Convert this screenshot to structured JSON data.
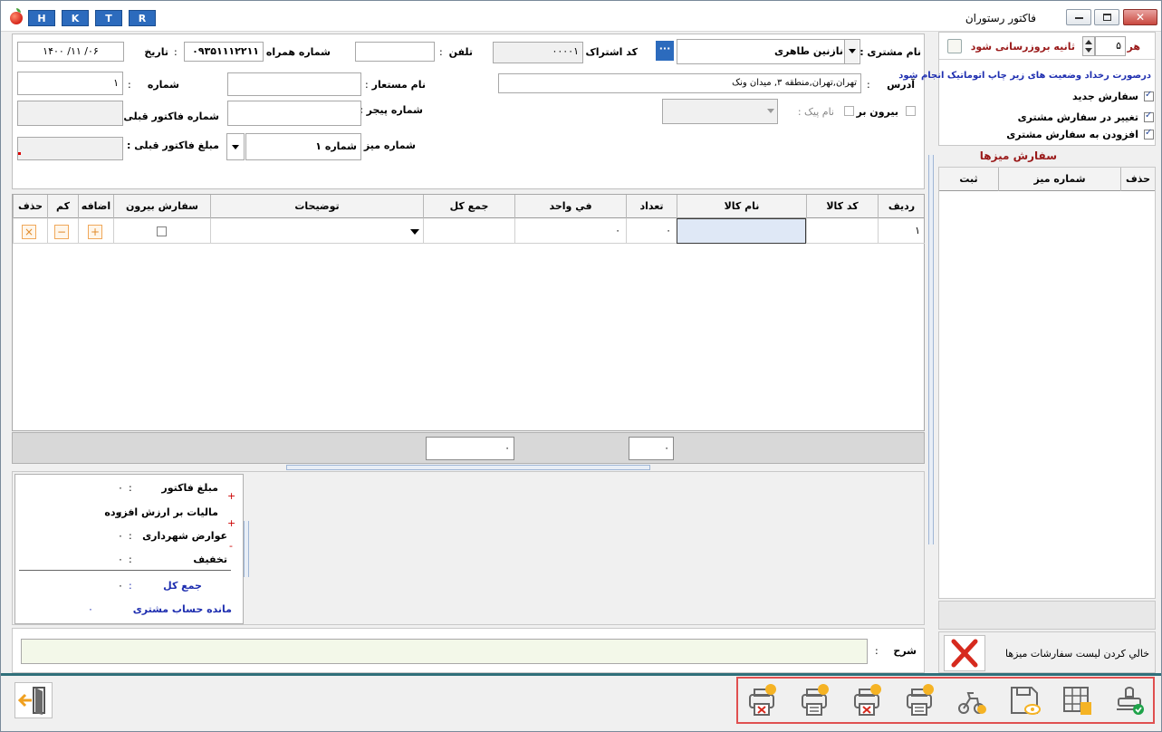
{
  "window": {
    "title": "فاكتور رستوران",
    "quick_buttons": [
      "H",
      "K",
      "T",
      "R"
    ]
  },
  "header": {
    "customer_name_label": "نام مشتری :",
    "customer_name_value": "نازنین طاهری",
    "subscription_code_label": "کد اشتراک :",
    "subscription_code_value": "۰۰۰۰۱",
    "phone_label": "تلفن",
    "phone_value": "",
    "mobile_label": "شماره همراه :",
    "mobile_value": "۰۹۳۵۱۱۱۲۲۱۱",
    "date_label": "تاریخ",
    "date_value": "۱۴۰۰  /۱۱  /۰۶",
    "address_label": "آدرس",
    "address_value": "تهران,تهران,منطقه ۳, میدان ونک",
    "alias_label": "نام مستعار",
    "alias_value": "",
    "number_label": "شماره",
    "number_value": "۱",
    "pager_label": "شماره پیجر :",
    "pager_value": "",
    "takeout_label": "بیرون بر",
    "courier_label": "نام پیک :",
    "courier_value": "",
    "prev_invoice_no_label": "شماره فاکتور قبلی :",
    "prev_invoice_no_value": "",
    "table_no_label": "شماره میز :",
    "table_no_value": "شماره ۱",
    "prev_invoice_amount_label": "مبلغ فاکتور قبلی :",
    "prev_invoice_amount_value": ""
  },
  "grid": {
    "columns": [
      "ردیف",
      "کد کالا",
      "نام کالا",
      "تعداد",
      "في واحد",
      "جمع کل",
      "توضیحات",
      "سفارش بیرون",
      "اضافه",
      "کم",
      "حذف"
    ],
    "row": {
      "index": "۱",
      "code": "",
      "name": "",
      "qty": "۰",
      "unit_price": "۰",
      "total": "",
      "notes": ""
    },
    "add_symbol": "+",
    "minus_symbol": "−",
    "delete_symbol": "×"
  },
  "totals_bar": {
    "qty_total": "۰",
    "sum_total": "۰"
  },
  "summary": {
    "invoice_amount_label": "مبلغ فاکتور",
    "invoice_amount_value": "۰",
    "vat_label": "مالیات بر ارزش افزوده",
    "vat_value": "۰",
    "municipal_label": "عوارض شهرداری",
    "municipal_value": "۰",
    "discount_label": "تخفیف",
    "discount_value": "۰",
    "grand_total_label": "جمع کل",
    "grand_total_value": "۰",
    "balance_label": "مانده حساب مشتری",
    "balance_value": "۰",
    "colon": ":",
    "plus": "+",
    "minus": "-"
  },
  "description": {
    "label": "شرح",
    "value": ""
  },
  "right_panel": {
    "every_label": "هر",
    "interval_value": "۵",
    "refresh_label": "ثانیه بروزرسانی شود",
    "auto_print_note": "درصورت رخداد وضعیت های زیر چاپ اتوماتیک انجام شود",
    "options": [
      "سفارش جدید",
      "تغییر در سفارش مشتری",
      "افزودن به سفارش مشتری"
    ],
    "table_orders_title": "سفارش میزها",
    "table_columns": [
      "حذف",
      "شماره میز",
      "ثبت"
    ],
    "clear_list_label": "خالي کردن لیست سفارشات میزها"
  },
  "toolbar": {
    "icons": [
      "cancel-print-icon",
      "print-icon",
      "cancel-print-2-icon",
      "print-invoice-icon",
      "delivery-icon",
      "save-view-icon",
      "table-invoice-icon",
      "confirm-stamp-icon"
    ]
  },
  "colors": {
    "accent_blue": "#2c6bbd",
    "highlight_red": "#e05050",
    "toolbar_icon": "#f5b324",
    "divider_teal": "#2f6f7a"
  }
}
